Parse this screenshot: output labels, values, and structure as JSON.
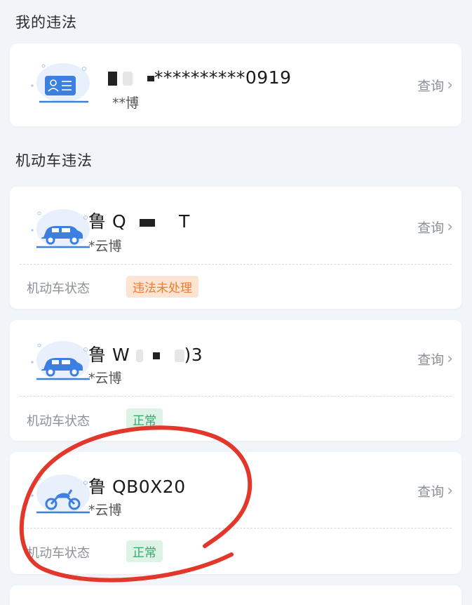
{
  "my_violations": {
    "title": "我的违法",
    "card": {
      "id_masked": "**********0919",
      "name_masked": "**博",
      "action": "查询"
    }
  },
  "vehicle_violations": {
    "title": "机动车违法",
    "vehicles": [
      {
        "plate_prefix": "鲁 Q",
        "plate_suffix": "T",
        "owner": "*云博",
        "action": "查询",
        "status_label": "机动车状态",
        "status": "违法未处理",
        "vehicle_icon": "car-icon"
      },
      {
        "plate_prefix": "鲁 W",
        "plate_suffix": ")3",
        "owner": "*云博",
        "action": "查询",
        "status_label": "机动车状态",
        "status": "正常",
        "vehicle_icon": "car-icon"
      },
      {
        "plate": "鲁 QB0X20",
        "owner": "*云博",
        "action": "查询",
        "status_label": "机动车状态",
        "status": "正常",
        "vehicle_icon": "motorcycle-icon"
      }
    ]
  },
  "colors": {
    "background": "#f1f4f9",
    "warn_badge": "#f07b31",
    "ok_badge": "#34a86b",
    "annotation_ring": "#e2372a",
    "icon_blue": "#3c7fe0"
  }
}
